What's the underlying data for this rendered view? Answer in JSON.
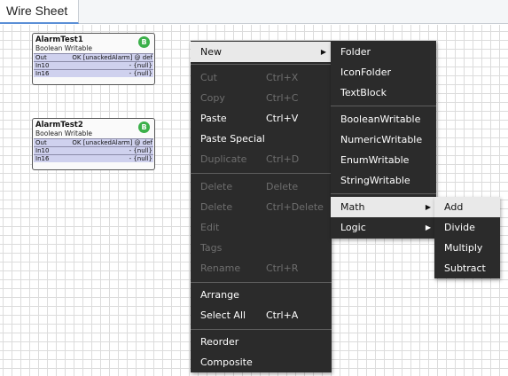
{
  "tab": {
    "label": "Wire Sheet"
  },
  "components": [
    {
      "name": "AlarmTest1",
      "type": "Boolean Writable",
      "badge": "B",
      "slots": [
        {
          "name": "Out",
          "value": "OK [unackedAlarm] @ def"
        },
        {
          "name": "In10",
          "value": "- {null}"
        },
        {
          "name": "In16",
          "value": "- {null}"
        }
      ]
    },
    {
      "name": "AlarmTest2",
      "type": "Boolean Writable",
      "badge": "B",
      "slots": [
        {
          "name": "Out",
          "value": "OK [unackedAlarm] @ def"
        },
        {
          "name": "In10",
          "value": "- {null}"
        },
        {
          "name": "In16",
          "value": "- {null}"
        }
      ]
    }
  ],
  "context_menu": {
    "new": {
      "label": "New"
    },
    "cut": {
      "label": "Cut",
      "shortcut": "Ctrl+X"
    },
    "copy": {
      "label": "Copy",
      "shortcut": "Ctrl+C"
    },
    "paste": {
      "label": "Paste",
      "shortcut": "Ctrl+V"
    },
    "paste_special": {
      "label": "Paste Special"
    },
    "duplicate": {
      "label": "Duplicate",
      "shortcut": "Ctrl+D"
    },
    "delete1": {
      "label": "Delete",
      "shortcut": "Delete"
    },
    "delete2": {
      "label": "Delete",
      "shortcut": "Ctrl+Delete"
    },
    "edit": {
      "label": "Edit"
    },
    "tags": {
      "label": "Tags"
    },
    "rename": {
      "label": "Rename",
      "shortcut": "Ctrl+R"
    },
    "arrange": {
      "label": "Arrange"
    },
    "select_all": {
      "label": "Select All",
      "shortcut": "Ctrl+A"
    },
    "reorder": {
      "label": "Reorder"
    },
    "composite": {
      "label": "Composite"
    }
  },
  "new_submenu": {
    "folder": "Folder",
    "icon_folder": "IconFolder",
    "text_block": "TextBlock",
    "boolean_writable": "BooleanWritable",
    "numeric_writable": "NumericWritable",
    "enum_writable": "EnumWritable",
    "string_writable": "StringWritable",
    "math": "Math",
    "logic": "Logic"
  },
  "math_submenu": {
    "add": "Add",
    "divide": "Divide",
    "multiply": "Multiply",
    "subtract": "Subtract"
  }
}
